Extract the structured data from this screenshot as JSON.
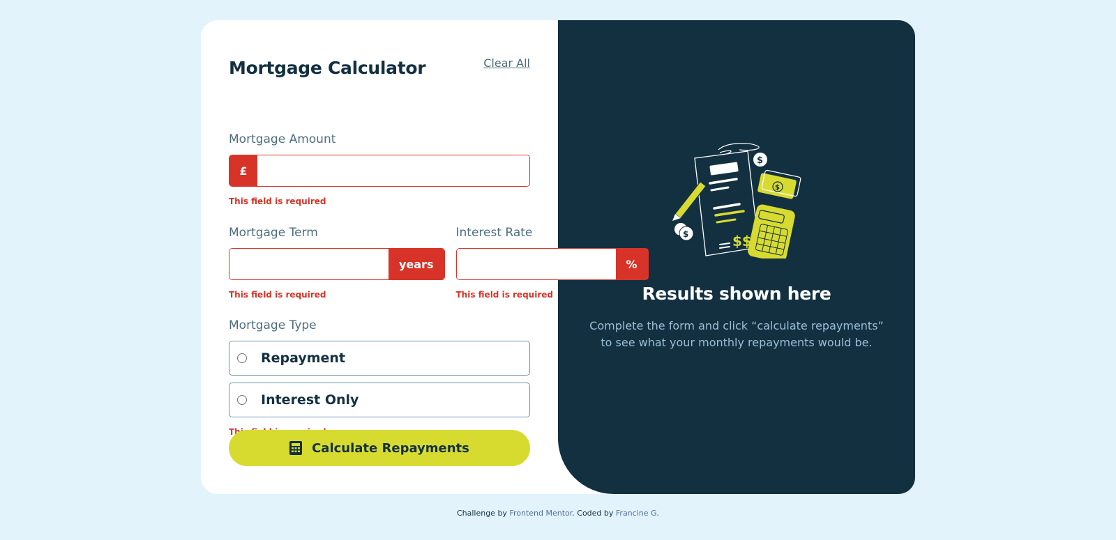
{
  "header": {
    "title": "Mortgage Calculator",
    "clear_label": "Clear All"
  },
  "fields": {
    "amount": {
      "label": "Mortgage Amount",
      "prefix": "£",
      "value": "",
      "error": "This field is required"
    },
    "term": {
      "label": "Mortgage Term",
      "suffix": "years",
      "value": "",
      "error": "This field is required"
    },
    "rate": {
      "label": "Interest Rate",
      "suffix": "%",
      "value": "",
      "error": "This field is required"
    }
  },
  "mortgage_type": {
    "label": "Mortgage Type",
    "options": [
      {
        "label": "Repayment",
        "selected": false
      },
      {
        "label": "Interest Only",
        "selected": false
      }
    ],
    "error": "This field is required"
  },
  "calculate": {
    "label": "Calculate Repayments",
    "icon": "calculator-icon"
  },
  "results": {
    "illustration": "empty-results-illustration",
    "title": "Results shown here",
    "description": "Complete the form and click “calculate repayments” to see what your monthly repayments would be."
  },
  "footer": {
    "prefix": "Challenge by ",
    "link1": "Frontend Mentor",
    "middle": ". Coded by ",
    "link2": "Francine G",
    "suffix": "."
  },
  "colors": {
    "background": "#e3f3fc",
    "dark": "#133041",
    "lime": "#d8db2f",
    "error": "#d73328",
    "slate": "#4e6e7e"
  }
}
